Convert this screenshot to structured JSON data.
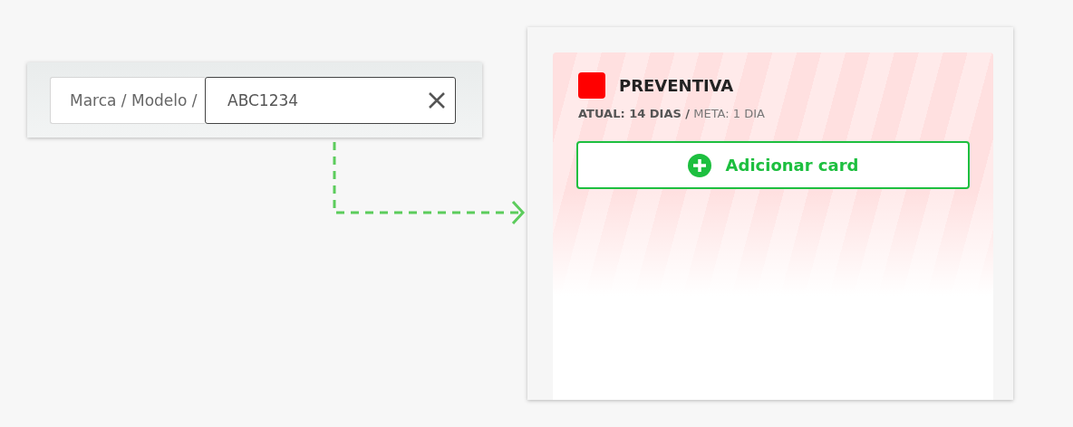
{
  "search_bar": {
    "prefix": "Marca / Modelo /",
    "value": "ABC1234"
  },
  "column": {
    "color": "#ff0000",
    "title": "PREVENTIVA",
    "metrics": "**ATUAL: 14 DIAS /** META: 1 DIA",
    "add_button": "Adicionar card"
  }
}
